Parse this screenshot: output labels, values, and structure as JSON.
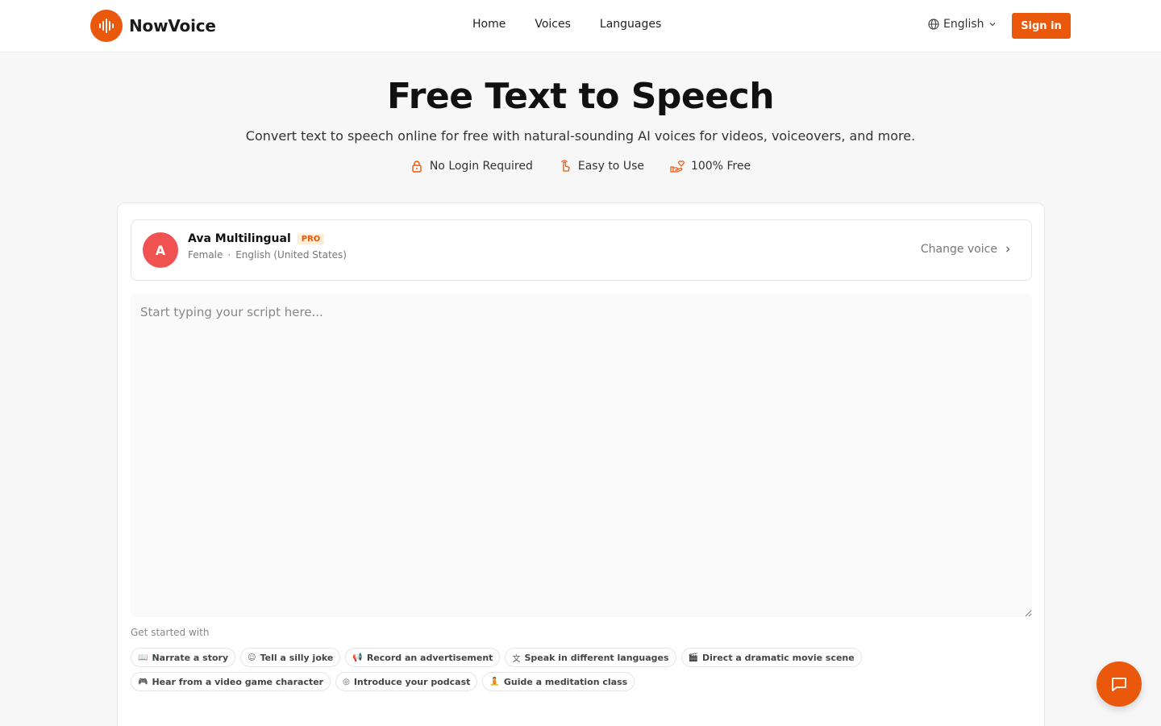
{
  "brand": {
    "name": "NowVoice",
    "accent_color": "#ea580c"
  },
  "nav": {
    "items": [
      "Home",
      "Voices",
      "Languages"
    ]
  },
  "header": {
    "language": "English",
    "sign_in": "Sign in"
  },
  "hero": {
    "title": "Free Text to Speech",
    "subtitle": "Convert text to speech online for free with natural-sounding AI voices for videos, voiceovers, and more.",
    "features": [
      {
        "icon": "lock-icon",
        "label": "No Login Required"
      },
      {
        "icon": "pointer-hand-icon",
        "label": "Easy to Use"
      },
      {
        "icon": "hand-heart-icon",
        "label": "100% Free"
      }
    ]
  },
  "voice": {
    "avatar_letter": "A",
    "name": "Ava Multilingual",
    "badge": "PRO",
    "gender": "Female",
    "separator": "·",
    "locale": "English (United States)",
    "change_label": "Change voice"
  },
  "editor": {
    "placeholder": "Start typing your script here..."
  },
  "get_started": {
    "label": "Get started with",
    "row1": [
      {
        "icon": "book-icon",
        "glyph": "📖",
        "label": "Narrate a story"
      },
      {
        "icon": "smile-icon",
        "glyph": "☺",
        "label": "Tell a silly joke"
      },
      {
        "icon": "megaphone-icon",
        "glyph": "📢",
        "label": "Record an advertisement"
      },
      {
        "icon": "translate-icon",
        "glyph": "文",
        "label": "Speak in different languages"
      },
      {
        "icon": "clapperboard-icon",
        "glyph": "🎬",
        "label": "Direct a dramatic movie scene"
      }
    ],
    "row2": [
      {
        "icon": "gamepad-icon",
        "glyph": "🎮",
        "label": "Hear from a video game character"
      },
      {
        "icon": "podcast-icon",
        "glyph": "◎",
        "label": "Introduce your podcast"
      },
      {
        "icon": "meditation-icon",
        "glyph": "🧘",
        "label": "Guide a meditation class"
      }
    ]
  }
}
